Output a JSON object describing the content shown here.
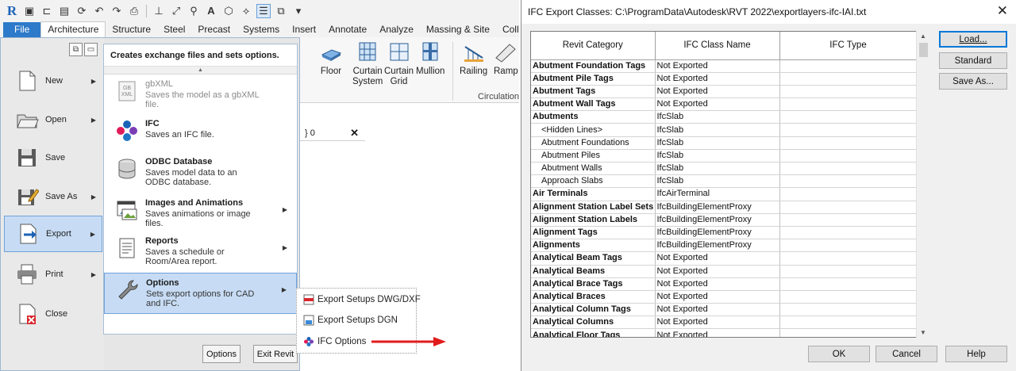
{
  "revit": {
    "tabs": [
      "File",
      "Architecture",
      "Structure",
      "Steel",
      "Precast",
      "Systems",
      "Insert",
      "Annotate",
      "Analyze",
      "Massing & Site",
      "Collaborate"
    ],
    "ribbon": {
      "floor": "Floor",
      "curtain_system": "Curtain\nSystem",
      "curtain_grid": "Curtain\nGrid",
      "mullion": "Mullion",
      "railing": "Railing",
      "ramp": "Ramp",
      "circulation": "Circulation"
    },
    "view_tab": {
      "label": "} 0",
      "close": "✕"
    },
    "app_menu": {
      "left_items": [
        {
          "label": "New",
          "icon": "new-document-icon",
          "has_arrow": true
        },
        {
          "label": "Open",
          "icon": "open-folder-icon",
          "has_arrow": true
        },
        {
          "label": "Save",
          "icon": "save-icon",
          "has_arrow": false
        },
        {
          "label": "Save As",
          "icon": "save-as-icon",
          "has_arrow": true
        },
        {
          "label": "Export",
          "icon": "export-icon",
          "has_arrow": true,
          "selected": true
        },
        {
          "label": "Print",
          "icon": "printer-icon",
          "has_arrow": true
        },
        {
          "label": "Close",
          "icon": "close-document-icon",
          "has_arrow": false
        }
      ],
      "panel_title": "Creates exchange files and sets options.",
      "panel_items": [
        {
          "title": "gbXML",
          "desc": "Saves the model as a gbXML file.",
          "icon": "gbxml-icon",
          "dim": true
        },
        {
          "title": "IFC",
          "desc": "Saves an IFC file.",
          "icon": "ifc-icon"
        },
        {
          "title": "ODBC Database",
          "desc": "Saves model data to an ODBC database.",
          "icon": "database-icon"
        },
        {
          "title": "Images and Animations",
          "desc": "Saves animations or image files.",
          "icon": "images-icon",
          "has_arrow": true
        },
        {
          "title": "Reports",
          "desc": "Saves a schedule or Room/Area report.",
          "icon": "reports-icon",
          "has_arrow": true
        },
        {
          "title": "Options",
          "desc": "Sets export options for CAD and IFC.",
          "icon": "wrench-icon",
          "has_arrow": true,
          "selected": true
        }
      ],
      "options_button": "Options",
      "exit_button": "Exit Revit"
    },
    "flyout": [
      {
        "label": "Export Setups DWG/DXF",
        "icon": "dwg-setup-icon"
      },
      {
        "label": "Export Setups DGN",
        "icon": "dgn-setup-icon"
      },
      {
        "label": "IFC Options",
        "icon": "ifc-options-icon"
      }
    ],
    "colors": {
      "file_tab": "#2c7ac9",
      "selection": "#c7dcf4",
      "arrow": "#e01b1b"
    }
  },
  "dialog": {
    "title": "IFC Export Classes: C:\\ProgramData\\Autodesk\\RVT 2022\\exportlayers-ifc-IAI.txt",
    "columns": [
      "Revit Category",
      "IFC Class Name",
      "IFC Type"
    ],
    "rows": [
      {
        "category": "Abutment Foundation Tags",
        "ifc_class": "Not Exported",
        "ifc_type": "",
        "child": false
      },
      {
        "category": "Abutment Pile Tags",
        "ifc_class": "Not Exported",
        "ifc_type": "",
        "child": false
      },
      {
        "category": "Abutment Tags",
        "ifc_class": "Not Exported",
        "ifc_type": "",
        "child": false
      },
      {
        "category": "Abutment Wall Tags",
        "ifc_class": "Not Exported",
        "ifc_type": "",
        "child": false
      },
      {
        "category": "Abutments",
        "ifc_class": "IfcSlab",
        "ifc_type": "",
        "child": false
      },
      {
        "category": "<Hidden Lines>",
        "ifc_class": "IfcSlab",
        "ifc_type": "",
        "child": true
      },
      {
        "category": "Abutment Foundations",
        "ifc_class": "IfcSlab",
        "ifc_type": "",
        "child": true
      },
      {
        "category": "Abutment Piles",
        "ifc_class": "IfcSlab",
        "ifc_type": "",
        "child": true
      },
      {
        "category": "Abutment Walls",
        "ifc_class": "IfcSlab",
        "ifc_type": "",
        "child": true
      },
      {
        "category": "Approach Slabs",
        "ifc_class": "IfcSlab",
        "ifc_type": "",
        "child": true
      },
      {
        "category": "Air Terminals",
        "ifc_class": "IfcAirTerminal",
        "ifc_type": "",
        "child": false
      },
      {
        "category": "Alignment Station Label Sets",
        "ifc_class": "IfcBuildingElementProxy",
        "ifc_type": "",
        "child": false
      },
      {
        "category": "Alignment Station Labels",
        "ifc_class": "IfcBuildingElementProxy",
        "ifc_type": "",
        "child": false
      },
      {
        "category": "Alignment Tags",
        "ifc_class": "IfcBuildingElementProxy",
        "ifc_type": "",
        "child": false
      },
      {
        "category": "Alignments",
        "ifc_class": "IfcBuildingElementProxy",
        "ifc_type": "",
        "child": false
      },
      {
        "category": "Analytical Beam Tags",
        "ifc_class": "Not Exported",
        "ifc_type": "",
        "child": false
      },
      {
        "category": "Analytical Beams",
        "ifc_class": "Not Exported",
        "ifc_type": "",
        "child": false
      },
      {
        "category": "Analytical Brace Tags",
        "ifc_class": "Not Exported",
        "ifc_type": "",
        "child": false
      },
      {
        "category": "Analytical Braces",
        "ifc_class": "Not Exported",
        "ifc_type": "",
        "child": false
      },
      {
        "category": "Analytical Column Tags",
        "ifc_class": "Not Exported",
        "ifc_type": "",
        "child": false
      },
      {
        "category": "Analytical Columns",
        "ifc_class": "Not Exported",
        "ifc_type": "",
        "child": false
      },
      {
        "category": "Analytical Floor Tags",
        "ifc_class": "Not Exported",
        "ifc_type": "",
        "child": false
      }
    ],
    "buttons": {
      "load": "Load...",
      "standard": "Standard",
      "save_as": "Save As...",
      "ok": "OK",
      "cancel": "Cancel",
      "help": "Help"
    }
  }
}
